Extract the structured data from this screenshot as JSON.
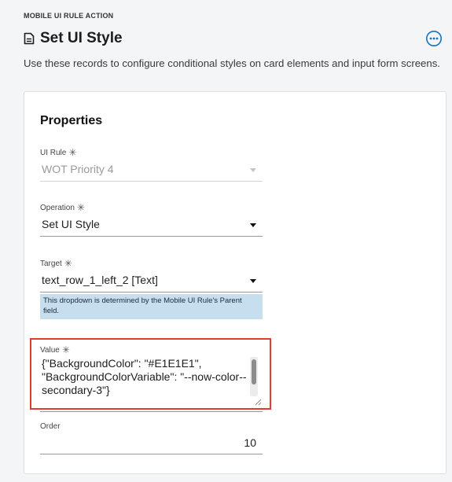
{
  "header": {
    "eyebrow": "MOBILE UI RULE ACTION",
    "title": "Set UI Style",
    "description": "Use these records to configure conditional styles on card elements and input form screens."
  },
  "icons": {
    "title_icon": "document-icon",
    "more": "more-options-icon"
  },
  "form": {
    "section_title": "Properties",
    "ui_rule": {
      "label": "UI Rule",
      "required_mark": "✳",
      "value": "WOT Priority 4",
      "disabled": true
    },
    "operation": {
      "label": "Operation",
      "required_mark": "✳",
      "value": "Set UI Style"
    },
    "target": {
      "label": "Target",
      "required_mark": "✳",
      "value": "text_row_1_left_2 [Text]",
      "help": "This dropdown is determined by the Mobile UI Rule's Parent field."
    },
    "value": {
      "label": "Value",
      "required_mark": "✳",
      "text": "{\"BackgroundColor\": \"#E1E1E1\", \"BackgroundColorVariable\": \"--now-color--secondary-3\"}"
    },
    "order": {
      "label": "Order",
      "value": "10"
    }
  },
  "colors": {
    "accent": "#1a73b8",
    "help_bg": "#c7deef",
    "highlight": "#e23b30"
  }
}
